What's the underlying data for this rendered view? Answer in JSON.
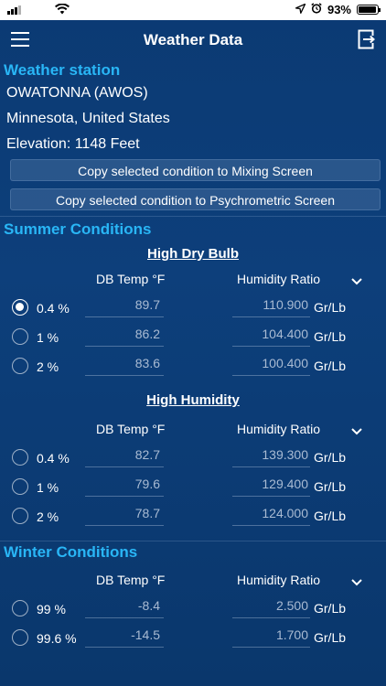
{
  "status_bar": {
    "battery": "93%",
    "battery_level": 0.93
  },
  "header": {
    "title": "Weather Data"
  },
  "station": {
    "heading": "Weather station",
    "name": "OWATONNA (AWOS)",
    "location": "Minnesota, United States",
    "elevation": "Elevation: 1148 Feet",
    "copy_mixing_label": "Copy selected condition to Mixing Screen",
    "copy_psychro_label": "Copy selected condition to Psychrometric Screen"
  },
  "columns": {
    "db_temp": "DB Temp °F",
    "humidity_ratio": "Humidity Ratio",
    "unit": "Gr/Lb"
  },
  "summer": {
    "heading": "Summer Conditions",
    "high_dry_bulb": {
      "title": "High Dry Bulb",
      "rows": [
        {
          "pct": "0.4 %",
          "db": "89.7",
          "hr": "110.900",
          "selected": true
        },
        {
          "pct": "1 %",
          "db": "86.2",
          "hr": "104.400",
          "selected": false
        },
        {
          "pct": "2 %",
          "db": "83.6",
          "hr": "100.400",
          "selected": false
        }
      ]
    },
    "high_humidity": {
      "title": "High Humidity",
      "rows": [
        {
          "pct": "0.4 %",
          "db": "82.7",
          "hr": "139.300",
          "selected": false
        },
        {
          "pct": "1 %",
          "db": "79.6",
          "hr": "129.400",
          "selected": false
        },
        {
          "pct": "2 %",
          "db": "78.7",
          "hr": "124.000",
          "selected": false
        }
      ]
    }
  },
  "winter": {
    "heading": "Winter Conditions",
    "rows": [
      {
        "pct": "99 %",
        "db": "-8.4",
        "hr": "2.500",
        "selected": false
      },
      {
        "pct": "99.6 %",
        "db": "-14.5",
        "hr": "1.700",
        "selected": false
      }
    ]
  },
  "icons": {
    "menu": "hamburger-menu-icon",
    "exit": "logout-icon",
    "chevron": "chevron-down-icon"
  }
}
